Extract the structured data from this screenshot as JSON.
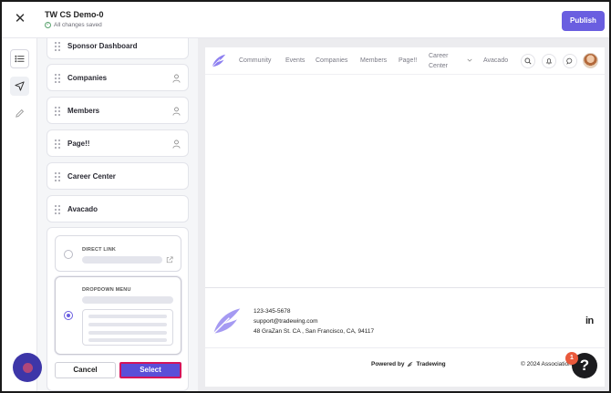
{
  "header": {
    "title": "TW CS Demo-0",
    "status": "All changes saved",
    "publish_label": "Publish"
  },
  "rail": {
    "items": [
      {
        "icon": "list-icon"
      },
      {
        "icon": "navigate-icon"
      },
      {
        "icon": "pencil-icon"
      }
    ]
  },
  "nav_items": [
    {
      "label": "Sponsor Dashboard",
      "restricted": false
    },
    {
      "label": "Companies",
      "restricted": true
    },
    {
      "label": "Members",
      "restricted": true
    },
    {
      "label": "Page!!",
      "restricted": true
    },
    {
      "label": "Career Center",
      "restricted": false
    },
    {
      "label": "Avacado",
      "restricted": false
    }
  ],
  "link_type": {
    "direct_link_label": "DIRECT LINK",
    "dropdown_menu_label": "DROPDOWN MENU",
    "selected": "dropdown_menu",
    "cancel_label": "Cancel",
    "select_label": "Select"
  },
  "preview": {
    "nav": [
      "Community",
      "Events",
      "Companies",
      "Members",
      "Page!!",
      "Career Center",
      "Avacado"
    ],
    "nav_career_line1": "Career",
    "nav_career_line2": "Center",
    "footer": {
      "phone": "123-345-5678",
      "email": "support@tradewing.com",
      "address": "48 GraZan St. CA , San Francisco, CA, 94117",
      "social": "in",
      "powered_prefix": "Powered by",
      "powered_brand": "Tradewing",
      "copyright": "© 2024 Association"
    }
  },
  "help": {
    "label": "?",
    "badge": "1"
  },
  "colors": {
    "accent": "#6a5ee0",
    "select_border": "#d4145a",
    "logo": "#8d7ff0"
  }
}
